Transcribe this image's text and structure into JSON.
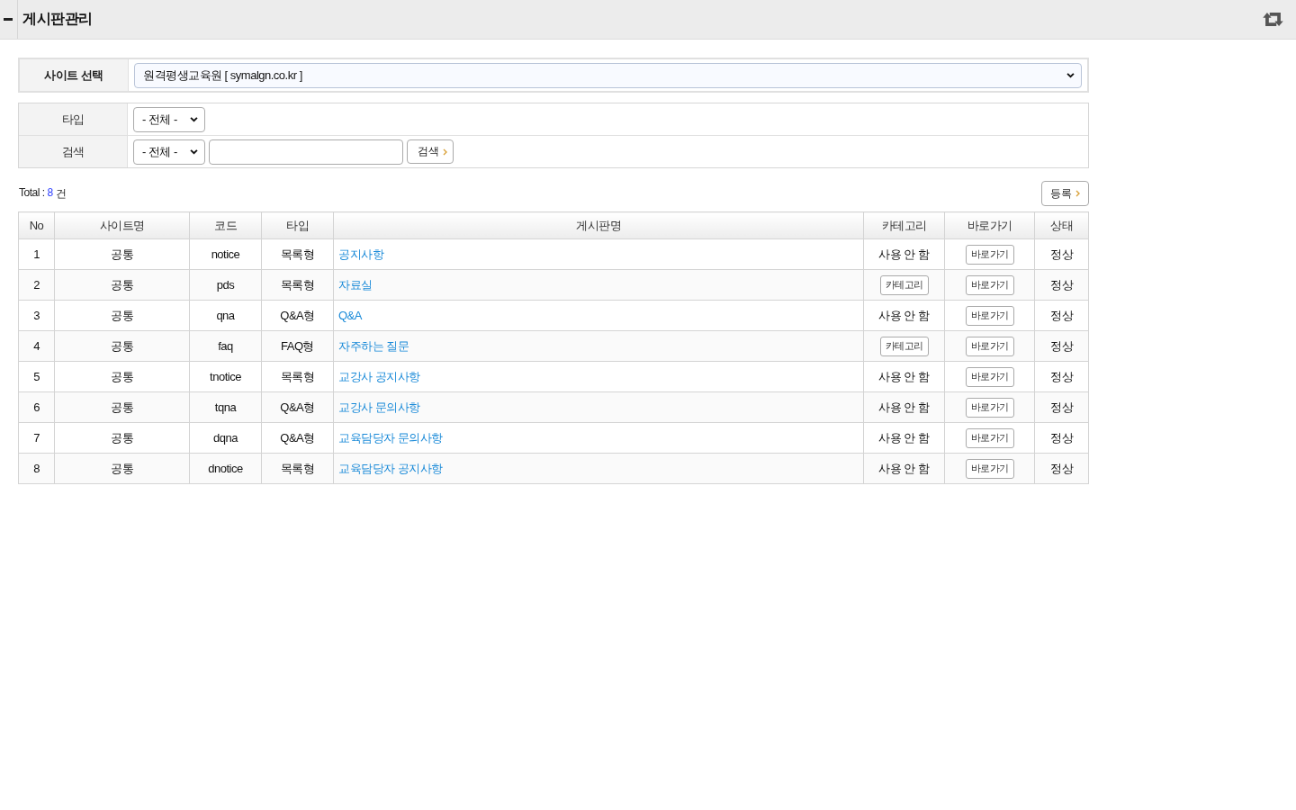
{
  "header": {
    "title": "게시판관리"
  },
  "site_select": {
    "label": "사이트 선택",
    "value": "원격평생교육원 [ symalgn.co.kr ]"
  },
  "type_filter": {
    "label": "타입",
    "value": "- 전체 -"
  },
  "search_filter": {
    "label": "검색",
    "value": "- 전체 -",
    "button": "검색"
  },
  "total": {
    "label": "Total :",
    "count": "8",
    "unit": "건"
  },
  "register_button": "등록",
  "table": {
    "columns": [
      "No",
      "사이트명",
      "코드",
      "타입",
      "게시판명",
      "카테고리",
      "바로가기",
      "상태"
    ],
    "rows": [
      {
        "no": "1",
        "site": "공통",
        "code": "notice",
        "type": "목록형",
        "name": "공지사항",
        "category": {
          "kind": "text",
          "label": "사용 안 함"
        },
        "goto": "바로가기",
        "status": "정상"
      },
      {
        "no": "2",
        "site": "공통",
        "code": "pds",
        "type": "목록형",
        "name": "자료실",
        "category": {
          "kind": "button",
          "label": "카테고리"
        },
        "goto": "바로가기",
        "status": "정상"
      },
      {
        "no": "3",
        "site": "공통",
        "code": "qna",
        "type": "Q&A형",
        "name": "Q&A",
        "category": {
          "kind": "text",
          "label": "사용 안 함"
        },
        "goto": "바로가기",
        "status": "정상"
      },
      {
        "no": "4",
        "site": "공통",
        "code": "faq",
        "type": "FAQ형",
        "name": "자주하는 질문",
        "category": {
          "kind": "button",
          "label": "카테고리"
        },
        "goto": "바로가기",
        "status": "정상"
      },
      {
        "no": "5",
        "site": "공통",
        "code": "tnotice",
        "type": "목록형",
        "name": "교강사 공지사항",
        "category": {
          "kind": "text",
          "label": "사용 안 함"
        },
        "goto": "바로가기",
        "status": "정상"
      },
      {
        "no": "6",
        "site": "공통",
        "code": "tqna",
        "type": "Q&A형",
        "name": "교강사 문의사항",
        "category": {
          "kind": "text",
          "label": "사용 안 함"
        },
        "goto": "바로가기",
        "status": "정상"
      },
      {
        "no": "7",
        "site": "공통",
        "code": "dqna",
        "type": "Q&A형",
        "name": "교육담당자 문의사항",
        "category": {
          "kind": "text",
          "label": "사용 안 함"
        },
        "goto": "바로가기",
        "status": "정상"
      },
      {
        "no": "8",
        "site": "공통",
        "code": "dnotice",
        "type": "목록형",
        "name": "교육담당자 공지사항",
        "category": {
          "kind": "text",
          "label": "사용 안 함"
        },
        "goto": "바로가기",
        "status": "정상"
      }
    ]
  }
}
